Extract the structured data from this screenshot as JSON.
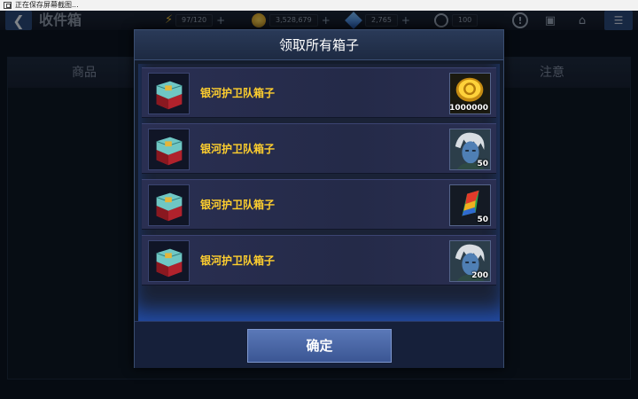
{
  "system_bar": {
    "text": "正在保存屏幕截图..."
  },
  "header": {
    "title": "收件箱",
    "energy": "97/120",
    "gold": "3,528,679",
    "crystals": "2,765",
    "timer": "100"
  },
  "inbox": {
    "columns": [
      "商品",
      "注意"
    ]
  },
  "modal": {
    "title": "领取所有箱子",
    "confirm_label": "确定",
    "items": [
      {
        "name": "银河护卫队箱子",
        "reward_icon": "gold-coin-icon",
        "quantity": "1000000"
      },
      {
        "name": "银河护卫队箱子",
        "reward_icon": "hero-portrait-icon",
        "quantity": "50"
      },
      {
        "name": "银河护卫队箱子",
        "reward_icon": "rainbow-crystal-icon",
        "quantity": "50"
      },
      {
        "name": "银河护卫队箱子",
        "reward_icon": "hero-portrait-icon",
        "quantity": "200"
      }
    ]
  },
  "colors": {
    "item_label": "#ffcf2e",
    "confirm_button": "#4a67a6",
    "modal_bg": "#131c2c"
  }
}
